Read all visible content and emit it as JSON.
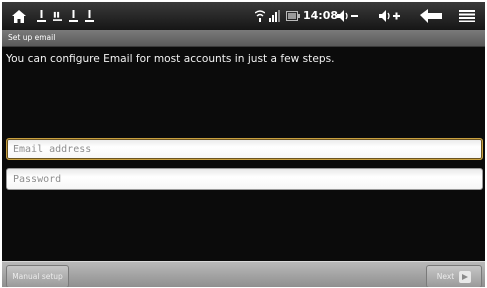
{
  "status_bar": {
    "icons": [
      "home-icon",
      "notification-icon",
      "notification-icon",
      "notification-icon",
      "notification-icon",
      "wifi-icon",
      "signal-icon",
      "battery-icon",
      "volume-down-icon",
      "volume-up-icon",
      "back-icon",
      "menu-icon"
    ],
    "time": "14:08"
  },
  "title_bar": {
    "title": "Set up email"
  },
  "content": {
    "intro": "You can configure Email for most accounts in just a few steps.",
    "email_placeholder": "Email address",
    "password_placeholder": "Password"
  },
  "bottom_bar": {
    "manual_setup_label": "Manual setup",
    "next_label": "Next"
  },
  "colors": {
    "background": "#0b0b0b",
    "status_bar": "#1e1e1e",
    "title_bar": "#6a6a6a",
    "bottom_bar": "#a4a4a4"
  }
}
